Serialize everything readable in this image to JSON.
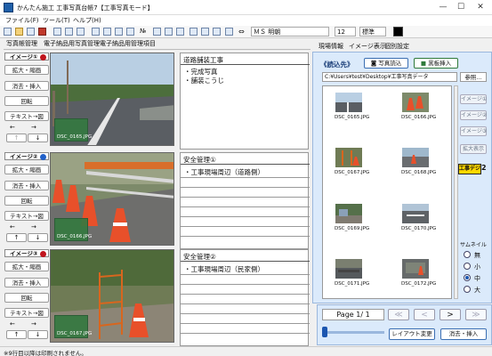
{
  "window": {
    "title": "かんたん施工 工事写真台帳7【工事写真モード】",
    "controls": [
      "—",
      "☐",
      "✕"
    ]
  },
  "menu": [
    "ファイル(F)",
    "ツール(T)",
    "ヘルプ(H)"
  ],
  "toolbar": {
    "no_label": "№",
    "font_name": "ＭＳ 明朝",
    "font_size": "12",
    "style": "標準"
  },
  "left_tabs": [
    "写真帳管理",
    "電子納品用写真管理",
    "電子納品用管理項目"
  ],
  "photo_blocks": [
    {
      "label": "イメージ①",
      "buttons": [
        "拡大・縮画",
        "消去・挿入",
        "回転",
        "テキスト→図"
      ],
      "filename": "DSC_0165.JPG",
      "card": {
        "title": "道路舗装工事",
        "lines": [
          "・完成写真",
          "・舗装こうじ"
        ]
      }
    },
    {
      "label": "イメージ②",
      "buttons": [
        "拡大・縮画",
        "消去・挿入",
        "回転",
        "テキスト→図"
      ],
      "filename": "DSC_0166.JPG",
      "card": {
        "title": "安全管理①",
        "lines": [
          "・工事現場周辺（道路側）"
        ]
      }
    },
    {
      "label": "イメージ③",
      "buttons": [
        "拡大・縮画",
        "消去・挿入",
        "回転",
        "テキスト→図"
      ],
      "filename": "DSC_0167.JPG",
      "card": {
        "title": "安全管理②",
        "lines": [
          "・工事現場周辺（民家側）"
        ]
      }
    }
  ],
  "right_tabs": [
    "現場情報",
    "イメージ表示",
    "個別設定"
  ],
  "reader": {
    "title": "《読込先》",
    "photo_read_button": "写真読込",
    "blackboard_button": "黒板挿入",
    "path": "C:¥Users¥test¥Desktop¥工事写真データ",
    "browse_button": "参照..."
  },
  "thumbnails": [
    "DSC_0165.JPG",
    "DSC_0166.JPG",
    "DSC_0167.JPG",
    "DSC_0168.JPG",
    "DSC_0169.JPG",
    "DSC_0170.JPG",
    "DSC_0171.JPG",
    "DSC_0172.JPG"
  ],
  "side_controls": {
    "image_buttons": [
      "イメージ①",
      "イメージ②",
      "イメージ③"
    ],
    "zoom_button": "拡大表示",
    "badge_text": "工事デジ",
    "badge_number": "2",
    "thumb_size_label": "サムネイル",
    "sizes": [
      "無",
      "小",
      "中",
      "大"
    ],
    "selected_size": "中"
  },
  "pagination": {
    "page_label": "Page 1/ 1",
    "first": "≪",
    "prev": "<",
    "next": ">",
    "last": "≫",
    "slider_value": 0.0,
    "layout_button": "レイアウト変更",
    "insert_button": "消去・挿入"
  },
  "status": "※9行目以降は印刷されません。",
  "colors": {
    "accent_blue": "#1c56b0",
    "panel_blue": "#dbeafb",
    "label_green": "#347840",
    "badge_yellow": "#ffd800"
  }
}
